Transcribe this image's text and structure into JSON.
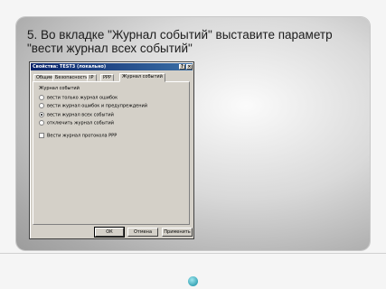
{
  "slide": {
    "title": "5. Во вкладке \"Журнал событий\" выставите параметр \"вести журнал всех событий\""
  },
  "dialog": {
    "title": "Свойства: TEST3 (локально)",
    "help_label": "?",
    "close_label": "×",
    "tabs": [
      "Общие",
      "Безопасность",
      "IP",
      "PPP",
      "Журнал событий"
    ],
    "active_tab": "Журнал событий",
    "group_label": "Журнал событий",
    "options": [
      {
        "label": "вести только журнал ошибок",
        "selected": false
      },
      {
        "label": "вести журнал ошибок и предупреждений",
        "selected": false
      },
      {
        "label": "вести журнал всех событий",
        "selected": true
      },
      {
        "label": "отключить журнал событий",
        "selected": false
      }
    ],
    "checkbox": {
      "label": "Вести журнал протокола PPP",
      "checked": false
    },
    "buttons": {
      "ok": "ОК",
      "cancel": "Отмена",
      "apply": "Применить"
    }
  }
}
